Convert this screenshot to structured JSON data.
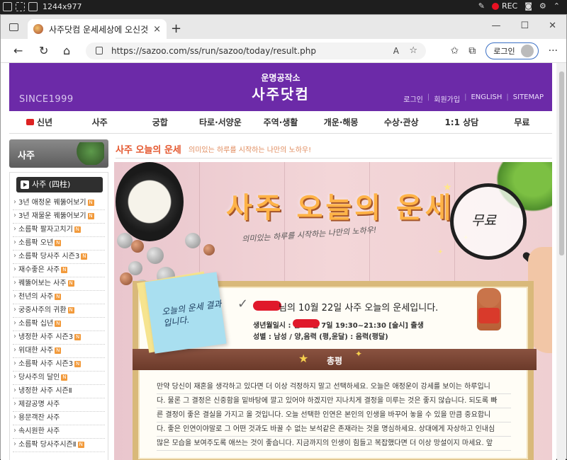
{
  "os_bar": {
    "resolution": "1244x977",
    "rec_label": "REC"
  },
  "browser": {
    "tab_title": "사주닷컴 운세세상에 오신것을 환영합니다",
    "url": "https://sazoo.com/ss/run/sazoo/today/result.php",
    "login_label": "로그인",
    "read_aloud": "A",
    "new_tab": "+",
    "close_tab": "×",
    "win_min": "—",
    "win_max": "☐",
    "win_close": "✕"
  },
  "site": {
    "since": "SINCE1999",
    "logo_sub": "운명공작소",
    "logo_main": "사주닷컴",
    "header_links": [
      "로그인",
      "회원가입",
      "ENGLISH",
      "SITEMAP"
    ],
    "separator": "|"
  },
  "gnb": [
    "신년",
    "사주",
    "궁합",
    "타로·서양운",
    "주역·생활",
    "개운·해몽",
    "수상·관상",
    "1:1 상담",
    "무료"
  ],
  "sidebar": {
    "heading": "사주",
    "subheading": "사주 (四柱)",
    "badge": "N",
    "items": [
      {
        "label": "3년 애정운 꿰뚫어보기",
        "badge": true
      },
      {
        "label": "3년 재물운 꿰뚫어보기",
        "badge": true
      },
      {
        "label": "소름팍 팔자고치기",
        "badge": true
      },
      {
        "label": "소름팍 오년",
        "badge": true
      },
      {
        "label": "소름팍 당사주 시즌3",
        "badge": true
      },
      {
        "label": "재수좋은 사주",
        "badge": true
      },
      {
        "label": "꿰뚫어보는 사주",
        "badge": true
      },
      {
        "label": "천년의 사주",
        "badge": true
      },
      {
        "label": "궁중사주의 귀환",
        "badge": true
      },
      {
        "label": "소름팍 십년",
        "badge": true
      },
      {
        "label": "냉정한 사주 시즌3",
        "badge": true
      },
      {
        "label": "위대한 사주",
        "badge": true
      },
      {
        "label": "소름팍 사주 시즌3",
        "badge": true
      },
      {
        "label": "당사주의 달인",
        "badge": true
      },
      {
        "label": "냉정한 사주 시즌Ⅱ",
        "badge": false
      },
      {
        "label": "제갈공명 사주",
        "badge": false
      },
      {
        "label": "용문객잔 사주",
        "badge": false
      },
      {
        "label": "속시원한 사주",
        "badge": false
      },
      {
        "label": "소름팍 당사주시즌Ⅱ",
        "badge": true
      }
    ]
  },
  "content": {
    "title": "사주 오늘의 운세",
    "description": "의미있는 하루를 시작하는 나만의 노하우!",
    "banner_title": "사주 오늘의 운세",
    "banner_subtitle": "의미있는 하루를 시작하는 나만의 노하우!",
    "badge_free": "무료",
    "postit": "오늘의 운세 결과입니다.",
    "check": "✓",
    "greeting": "님의 10월 22일 사주 오늘의 운세입니다.",
    "birth": "생년월일시 : 년 11월 7일 19:30~21:30 [술시] 출생",
    "gender": "성별 : 남성 / 양,음력 (평,윤달) : 음력(평달)",
    "section_label": "총평",
    "paragraph_lines": [
      "만약 당신이 재혼을 생각하고 있다면 더 이상 걱정하지 말고 선택하세요. 오늘은 애정운이 강세를 보이는 하루입니",
      "다. 물론 그 결정은 신중함을 밑바탕에 깔고 있어야 하겠지만 지나치게 결정을 미루는 것은 좋지 않습니다. 되도록 빠",
      "른 결정이 좋은 결실을 가지고 올 것입니다. 오늘 선택한 인연은 본인의 인생을 바꾸어 놓을 수 있을 만큼 중요합니",
      "다. 좋은 인연이야말로 그 어떤 것과도 바꿀 수 없는 보석같은 존재라는 것을 명심하세요. 상대에게 자상하고 인내심",
      "많은 모습을 보여주도록 애쓰는 것이 좋습니다. 지금까지의 인생이 힘들고 복잡했다면 더 이상 망설이지 마세요. 앞"
    ]
  },
  "colors": {
    "header_purple": "#6c2aa8",
    "title_orange": "#e4572e",
    "bar_brown": "#6b3a2a",
    "redaction": "#e0192b"
  }
}
